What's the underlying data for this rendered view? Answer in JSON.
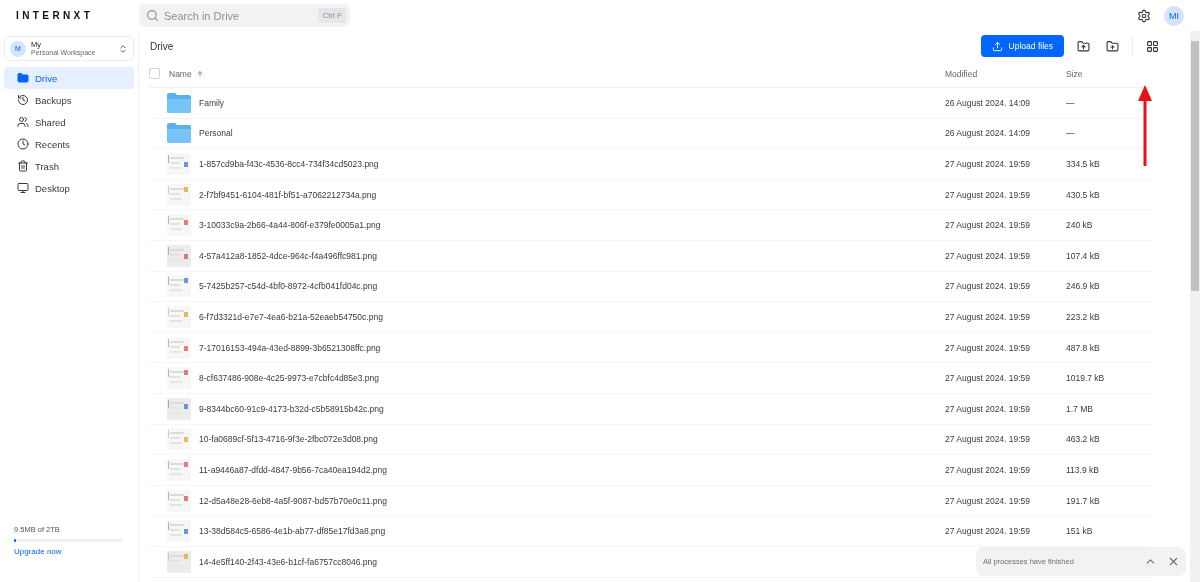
{
  "header": {
    "logo": "INTERNXT",
    "search": {
      "placeholder": "Search in Drive",
      "shortcut": "Ctrl F"
    },
    "avatar": "MI"
  },
  "sidebar": {
    "workspace": {
      "initial": "M",
      "name": "My",
      "subtitle": "Personal Workspace"
    },
    "items": [
      {
        "label": "Drive",
        "kind": "drive",
        "selected": true
      },
      {
        "label": "Backups",
        "kind": "backups",
        "selected": false
      },
      {
        "label": "Shared",
        "kind": "shared",
        "selected": false
      },
      {
        "label": "Recents",
        "kind": "recents",
        "selected": false
      },
      {
        "label": "Trash",
        "kind": "trash",
        "selected": false
      },
      {
        "label": "Desktop",
        "kind": "desktop",
        "selected": false
      }
    ],
    "storage": {
      "usage": "9.5MB of 2TB",
      "level": 0.01,
      "upgrade": "Upgrade now"
    }
  },
  "main": {
    "breadcrumb": "Drive",
    "upload_button": "Upload files",
    "table": {
      "select_all": {
        "checked": false
      },
      "columns": [
        "Name",
        "Modified",
        "Size"
      ],
      "rows": [
        {
          "kind": "folder",
          "name": "Family",
          "modified": "26 August 2024. 14:09",
          "size": "—"
        },
        {
          "kind": "folder",
          "name": "Personal",
          "modified": "26 August 2024. 14:09",
          "size": "—"
        },
        {
          "name": "1-857cd9ba-f43c-4536-8cc4-734f34cd5023.png",
          "modified": "27 August 2024. 19:59",
          "size": "334.5 kB"
        },
        {
          "name": "2-f7bf9451-6104-481f-bf51-a7062212734a.png",
          "modified": "27 August 2024. 19:59",
          "size": "430.5 kB"
        },
        {
          "name": "3-10033c9a-2b66-4a44-806f-e379fe0005a1.png",
          "modified": "27 August 2024. 19:59",
          "size": "240 kB"
        },
        {
          "name": "4-57a412a8-1852-4dce-964c-f4a496ffc981.png",
          "modified": "27 August 2024. 19:59",
          "size": "107.4 kB"
        },
        {
          "name": "5-7425b257-c54d-4bf0-8972-4cfb041fd04c.png",
          "modified": "27 August 2024. 19:59",
          "size": "246.9 kB"
        },
        {
          "name": "6-f7d3321d-e7e7-4ea6-b21a-52eaeb54750c.png",
          "modified": "27 August 2024. 19:59",
          "size": "223.2 kB"
        },
        {
          "name": "7-17016153-494a-43ed-8899-3b6521308ffc.png",
          "modified": "27 August 2024. 19:59",
          "size": "487.8 kB"
        },
        {
          "name": "8-cf637486-908e-4c25-9973-e7cbfc4d85e3.png",
          "modified": "27 August 2024. 19:59",
          "size": "1019.7 kB"
        },
        {
          "name": "9-8344bc60-91c9-4173-b32d-c5b58915b42c.png",
          "modified": "27 August 2024. 19:59",
          "size": "1.7 MB"
        },
        {
          "name": "10-fa0689cf-5f13-4716-9f3e-2fbc072e3d08.png",
          "modified": "27 August 2024. 19:59",
          "size": "463.2 kB"
        },
        {
          "name": "11-a9446a87-dfdd-4847-9b56-7ca40ea194d2.png",
          "modified": "27 August 2024. 19:59",
          "size": "113.9 kB"
        },
        {
          "name": "12-d5a48e28-6eb8-4a5f-9087-bd57b70e0c11.png",
          "modified": "27 August 2024. 19:59",
          "size": "191.7 kB"
        },
        {
          "name": "13-38d584c5-6586-4e1b-ab77-df85e17fd3a8.png",
          "modified": "27 August 2024. 19:59",
          "size": "151 kB"
        },
        {
          "name": "14-4e5ff140-2f43-43e6-b1cf-fa6757cc8046.png"
        }
      ]
    }
  },
  "toast": {
    "message": "All processes have finished"
  }
}
